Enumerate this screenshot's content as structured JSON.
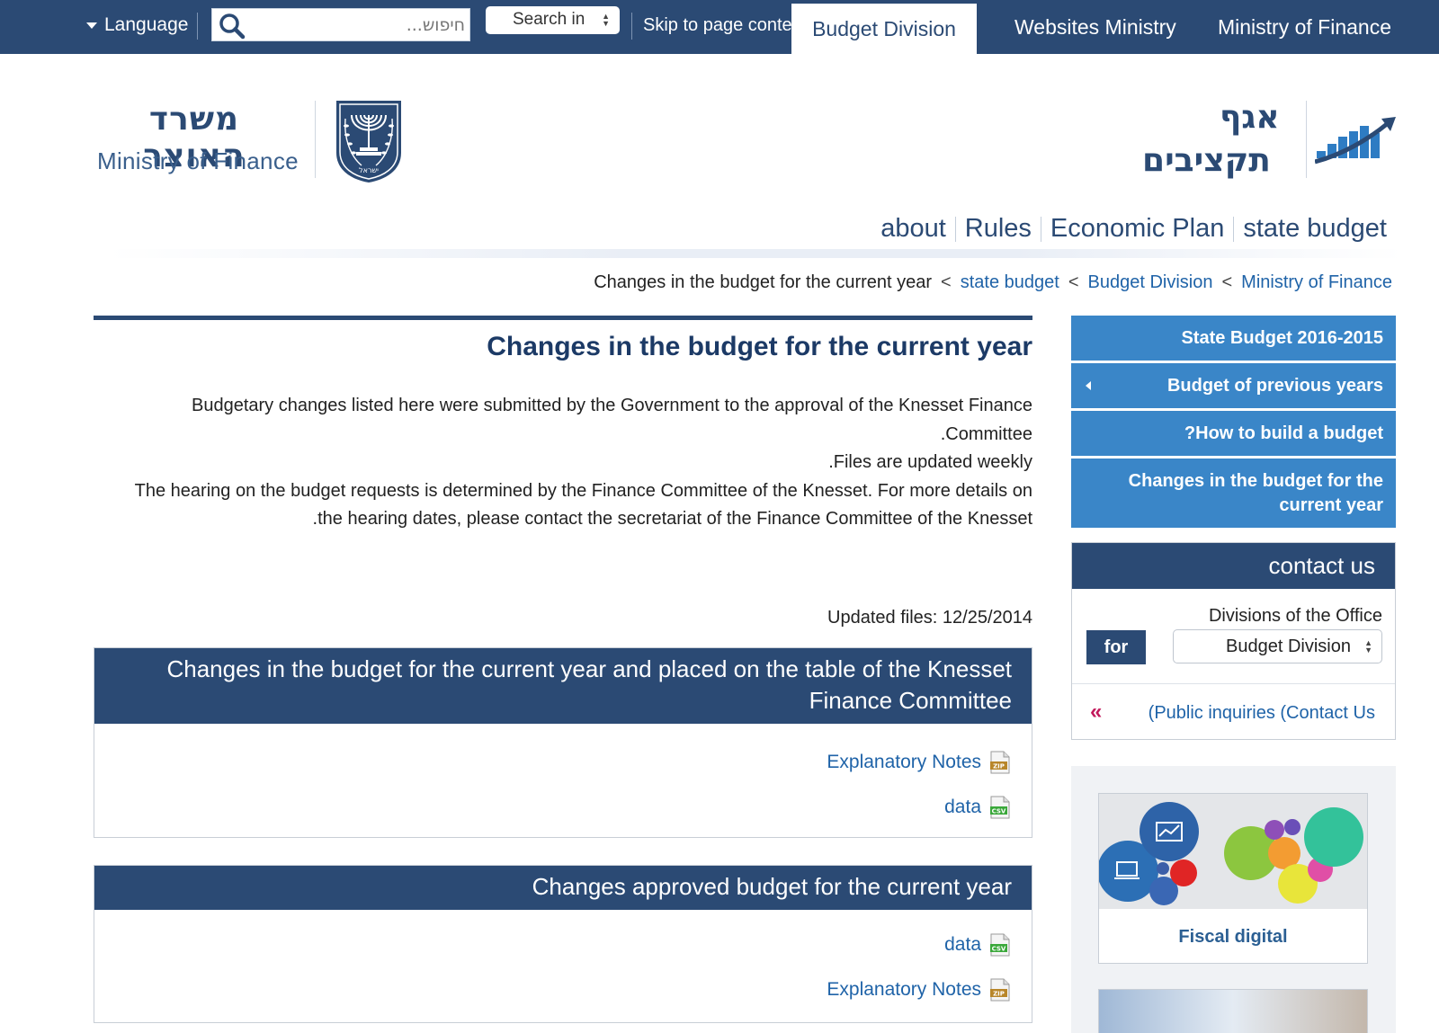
{
  "topbar": {
    "language_label": "Language",
    "search_placeholder": "חיפוש...",
    "search_in_label": "Search in",
    "skip_label": "Skip to page content",
    "tabs": [
      "Budget Division",
      "Websites Ministry",
      "Ministry of Finance"
    ]
  },
  "header": {
    "ministry_hebrew": "משרד האוצר",
    "ministry_english": "Ministry of Finance",
    "division_hebrew_line1": "אגף",
    "division_hebrew_line2": "תקציבים",
    "emblem_text": "ישראל"
  },
  "mainnav": {
    "items": [
      "about",
      "Rules",
      "Economic Plan",
      "state budget"
    ]
  },
  "breadcrumb": {
    "current": "Changes in the budget for the current year",
    "links": [
      "state budget",
      "Budget Division",
      "Ministry of Finance"
    ],
    "separator": "<"
  },
  "content": {
    "title": "Changes in the budget for the current year",
    "intro_lines": [
      "Budgetary changes listed here were submitted by the Government to the approval of the Knesset Finance Committee.",
      "Files are updated weekly.",
      "The hearing on the budget requests is determined by the Finance Committee of the Knesset. For more details on the hearing dates, please contact the secretariat of the Finance Committee of the Knesset."
    ],
    "updated": "Updated files: 12/25/2014",
    "panels": [
      {
        "title": "Changes in the budget for the current year and placed on the table of the Knesset Finance Committee",
        "files": [
          {
            "label": "Explanatory Notes",
            "icon": "zip-file-icon",
            "badge": "ZIP"
          },
          {
            "label": "data",
            "icon": "csv-file-icon",
            "badge": "CSV"
          }
        ]
      },
      {
        "title": "Changes approved budget for the current year",
        "files": [
          {
            "label": "data",
            "icon": "csv-file-icon",
            "badge": "CSV"
          },
          {
            "label": "Explanatory Notes",
            "icon": "zip-file-icon",
            "badge": "ZIP"
          }
        ]
      }
    ]
  },
  "sidebar": {
    "menu": [
      "State Budget 2016-2015",
      "Budget of previous years",
      "?How to build a budget",
      "Changes in the budget for the current year"
    ],
    "contact": {
      "title": "contact us",
      "divisions_label": "Divisions of the Office",
      "for_label": "for",
      "selected_division": "Budget Division",
      "public_inquiries": "(Public inquiries (Contact Us"
    },
    "promo": {
      "label": "Fiscal digital"
    }
  },
  "colors": {
    "navy": "#2b4a74",
    "menu_blue": "#3a86c8",
    "link_blue": "#1f63a8",
    "accent_pink": "#c2185b"
  }
}
